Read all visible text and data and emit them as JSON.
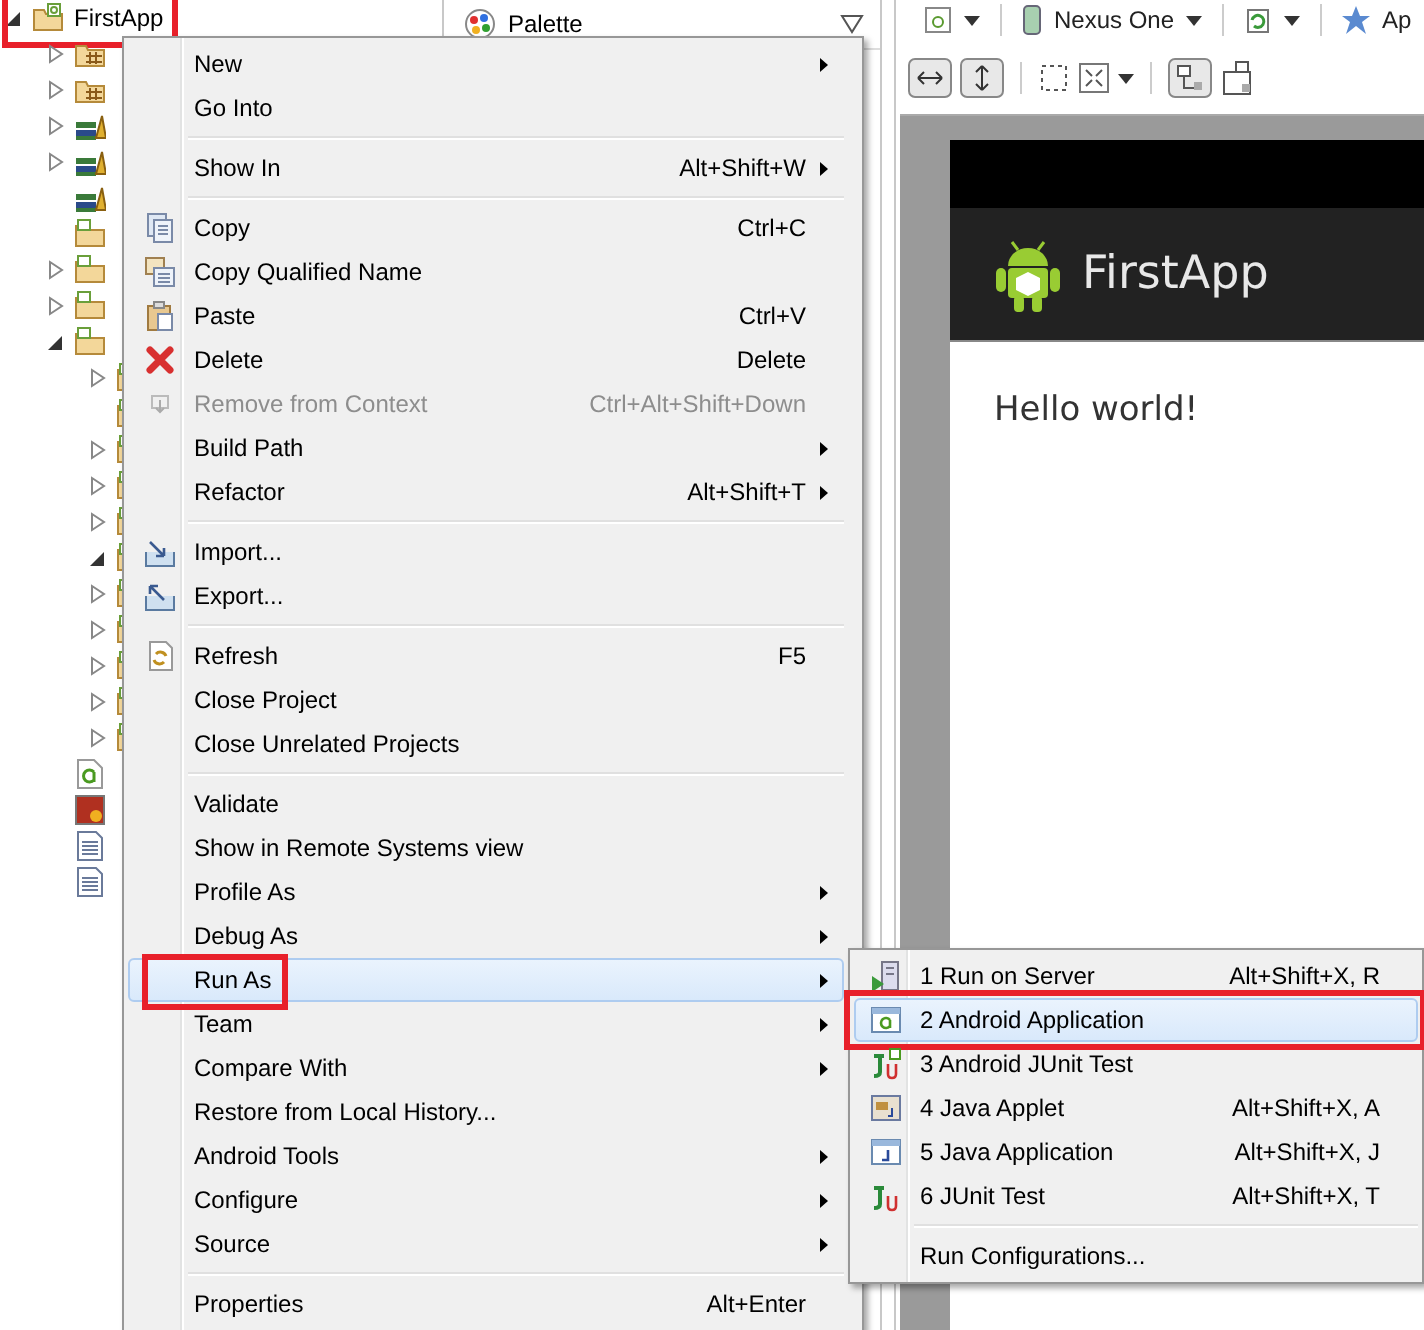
{
  "project_tree": {
    "items": [
      {
        "kind": "project",
        "label": "FirstApp",
        "expanded": true,
        "annotated": true,
        "children": [
          {
            "kind": "source",
            "expanded": false
          },
          {
            "kind": "source",
            "expanded": false
          },
          {
            "kind": "library",
            "expanded": false
          },
          {
            "kind": "library",
            "expanded": false
          },
          {
            "kind": "library"
          },
          {
            "kind": "folder"
          },
          {
            "kind": "folder",
            "expanded": false
          },
          {
            "kind": "folder",
            "expanded": false
          },
          {
            "kind": "folder",
            "expanded": true,
            "children": [
              {
                "kind": "folder",
                "expanded": false
              },
              {
                "kind": "folder"
              },
              {
                "kind": "folder",
                "expanded": false
              },
              {
                "kind": "folder",
                "expanded": false
              },
              {
                "kind": "folder",
                "expanded": false
              },
              {
                "kind": "folder",
                "expanded": true
              },
              {
                "kind": "folder",
                "expanded": false
              },
              {
                "kind": "folder",
                "expanded": false
              },
              {
                "kind": "folder",
                "expanded": false
              },
              {
                "kind": "folder",
                "expanded": false
              },
              {
                "kind": "folder",
                "expanded": false
              }
            ]
          },
          {
            "kind": "android"
          },
          {
            "kind": "image"
          },
          {
            "kind": "text"
          },
          {
            "kind": "text"
          }
        ]
      }
    ]
  },
  "palette": {
    "title": "Palette"
  },
  "editor_toolbar": {
    "device": "Nexus One",
    "truncated_item": "Ap"
  },
  "preview": {
    "app_title": "FirstApp",
    "content": "Hello world!"
  },
  "context_menu": {
    "items": [
      {
        "kind": "item",
        "label": "New",
        "submenu": true,
        "disabled": false,
        "selected": false
      },
      {
        "kind": "item",
        "label": "Go Into",
        "submenu": false,
        "disabled": false,
        "selected": false
      },
      {
        "kind": "separator"
      },
      {
        "kind": "item",
        "label": "Show In",
        "shortcut": "Alt+Shift+W",
        "submenu": true,
        "disabled": false,
        "selected": false
      },
      {
        "kind": "separator"
      },
      {
        "kind": "copy",
        "label": "Copy",
        "shortcut": "Ctrl+C",
        "submenu": false,
        "disabled": false,
        "selected": false
      },
      {
        "kind": "copy-name",
        "label": "Copy Qualified Name",
        "submenu": false,
        "disabled": false,
        "selected": false
      },
      {
        "kind": "paste",
        "label": "Paste",
        "shortcut": "Ctrl+V",
        "submenu": false,
        "disabled": false,
        "selected": false
      },
      {
        "kind": "delete",
        "label": "Delete",
        "shortcut": "Delete",
        "submenu": false,
        "disabled": false,
        "selected": false
      },
      {
        "kind": "remove",
        "label": "Remove from Context",
        "shortcut": "Ctrl+Alt+Shift+Down",
        "submenu": false,
        "disabled": true,
        "selected": false
      },
      {
        "kind": "item",
        "label": "Build Path",
        "submenu": true,
        "disabled": false,
        "selected": false
      },
      {
        "kind": "item",
        "label": "Refactor",
        "shortcut": "Alt+Shift+T",
        "submenu": true,
        "disabled": false,
        "selected": false
      },
      {
        "kind": "separator"
      },
      {
        "kind": "import",
        "label": "Import...",
        "submenu": false,
        "disabled": false,
        "selected": false
      },
      {
        "kind": "export",
        "label": "Export...",
        "submenu": false,
        "disabled": false,
        "selected": false
      },
      {
        "kind": "separator"
      },
      {
        "kind": "refresh",
        "label": "Refresh",
        "shortcut": "F5",
        "submenu": false,
        "disabled": false,
        "selected": false
      },
      {
        "kind": "item",
        "label": "Close Project",
        "submenu": false,
        "disabled": false,
        "selected": false
      },
      {
        "kind": "item",
        "label": "Close Unrelated Projects",
        "submenu": false,
        "disabled": false,
        "selected": false
      },
      {
        "kind": "separator"
      },
      {
        "kind": "item",
        "label": "Validate",
        "submenu": false,
        "disabled": false,
        "selected": false
      },
      {
        "kind": "item",
        "label": "Show in Remote Systems view",
        "submenu": false,
        "disabled": false,
        "selected": false
      },
      {
        "kind": "item",
        "label": "Profile As",
        "submenu": true,
        "disabled": false,
        "selected": false
      },
      {
        "kind": "item",
        "label": "Debug As",
        "submenu": true,
        "disabled": false,
        "selected": false
      },
      {
        "kind": "item",
        "label": "Run As",
        "submenu": true,
        "disabled": false,
        "selected": true,
        "annotated": true
      },
      {
        "kind": "item",
        "label": "Team",
        "submenu": true,
        "disabled": false,
        "selected": false
      },
      {
        "kind": "item",
        "label": "Compare With",
        "submenu": true,
        "disabled": false,
        "selected": false
      },
      {
        "kind": "item",
        "label": "Restore from Local History...",
        "submenu": false,
        "disabled": false,
        "selected": false
      },
      {
        "kind": "item",
        "label": "Android Tools",
        "submenu": true,
        "disabled": false,
        "selected": false
      },
      {
        "kind": "item",
        "label": "Configure",
        "submenu": true,
        "disabled": false,
        "selected": false
      },
      {
        "kind": "item",
        "label": "Source",
        "submenu": true,
        "disabled": false,
        "selected": false
      },
      {
        "kind": "separator"
      },
      {
        "kind": "item",
        "label": "Properties",
        "shortcut": "Alt+Enter",
        "submenu": false,
        "disabled": false,
        "selected": false
      }
    ]
  },
  "run_as_submenu": {
    "items": [
      {
        "kind": "server",
        "label": "1 Run on Server",
        "shortcut": "Alt+Shift+X, R",
        "disabled": false,
        "selected": false
      },
      {
        "kind": "android-app",
        "label": "2 Android Application",
        "disabled": false,
        "selected": true,
        "annotated": true
      },
      {
        "kind": "junit-android",
        "label": "3 Android JUnit Test",
        "disabled": false,
        "selected": false
      },
      {
        "kind": "applet",
        "label": "4 Java Applet",
        "shortcut": "Alt+Shift+X, A",
        "disabled": false,
        "selected": false
      },
      {
        "kind": "java-app",
        "label": "5 Java Application",
        "shortcut": "Alt+Shift+X, J",
        "disabled": false,
        "selected": false
      },
      {
        "kind": "junit",
        "label": "6 JUnit Test",
        "shortcut": "Alt+Shift+X, T",
        "disabled": false,
        "selected": false
      },
      {
        "kind": "separator"
      },
      {
        "kind": "item",
        "label": "Run Configurations...",
        "disabled": false,
        "selected": false
      }
    ]
  }
}
